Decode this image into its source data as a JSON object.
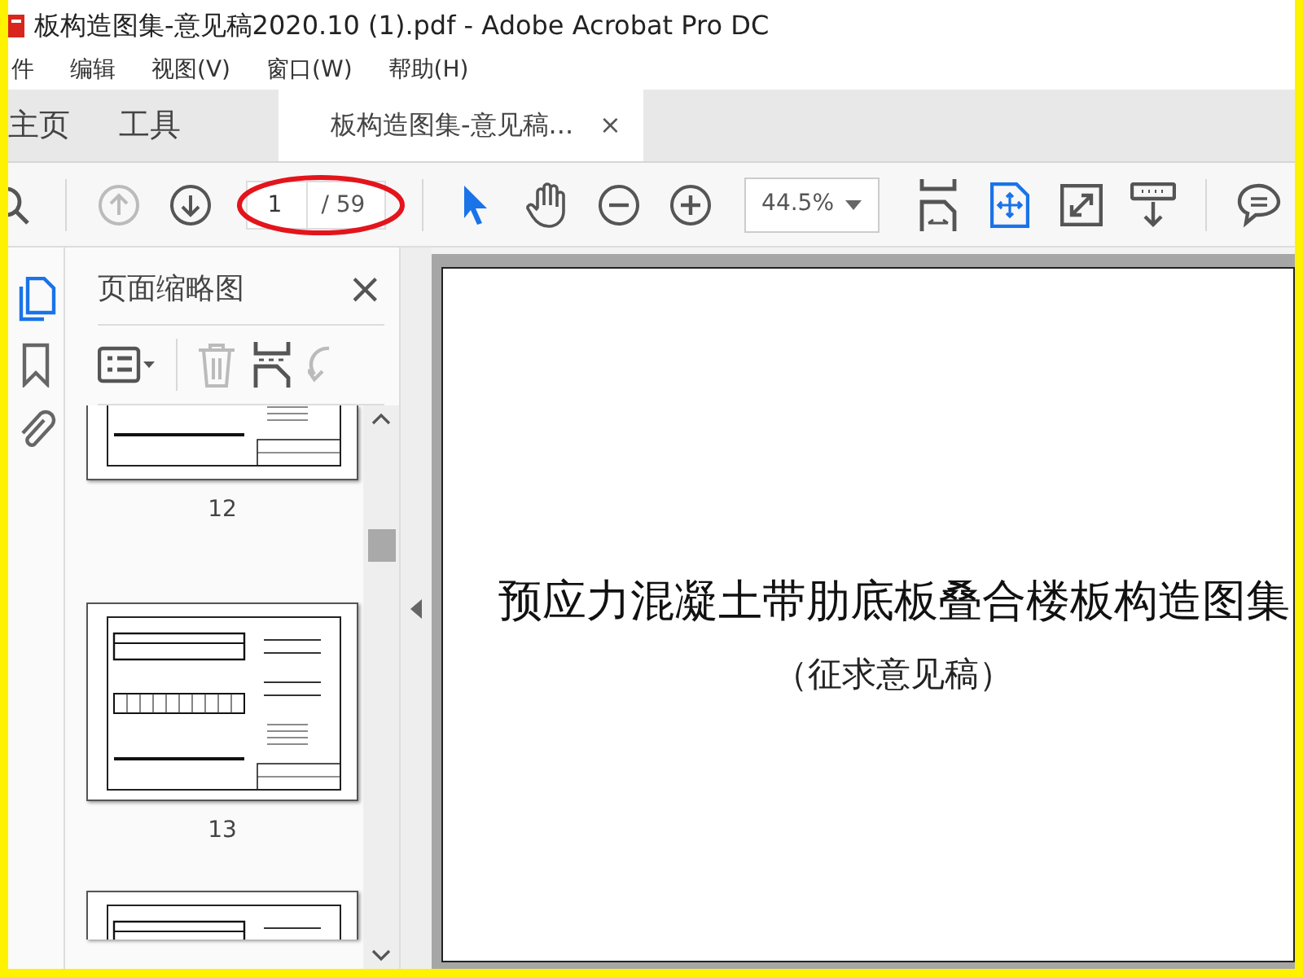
{
  "window": {
    "title": "板构造图集-意见稿2020.10 (1).pdf - Adobe Acrobat Pro DC"
  },
  "menu": [
    "件",
    "编辑",
    "视图(V)",
    "窗口(W)",
    "帮助(H)"
  ],
  "tabs": [
    {
      "label": "主页",
      "kind": "nav",
      "selected": false
    },
    {
      "label": "工具",
      "kind": "nav",
      "selected": false
    },
    {
      "label": "板构造图集-意见稿...",
      "kind": "document",
      "selected": true,
      "close": "×"
    }
  ],
  "toolbar": {
    "tools": [
      {
        "kind": "search",
        "disabled": false,
        "selected": false
      },
      {
        "kind": "divider"
      },
      {
        "kind": "prev-page",
        "disabled": true,
        "selected": false
      },
      {
        "kind": "next-page",
        "disabled": false,
        "selected": false
      },
      {
        "kind": "page-field",
        "value": "1",
        "total": "/ 59",
        "circled": true
      },
      {
        "kind": "divider"
      },
      {
        "kind": "select",
        "disabled": false,
        "selected": true
      },
      {
        "kind": "hand",
        "disabled": false,
        "selected": false
      },
      {
        "kind": "zoom-out",
        "disabled": false,
        "selected": false
      },
      {
        "kind": "zoom-in",
        "disabled": false,
        "selected": false
      },
      {
        "kind": "zoom-field",
        "value": "44.5%"
      },
      {
        "kind": "scroll-mode",
        "disabled": false,
        "selected": false
      },
      {
        "kind": "fit-page",
        "disabled": false,
        "selected": true
      },
      {
        "kind": "full-screen",
        "disabled": false,
        "selected": false
      },
      {
        "kind": "read-mode",
        "disabled": false,
        "selected": false
      },
      {
        "kind": "divider"
      },
      {
        "kind": "comment",
        "disabled": false,
        "selected": false
      }
    ]
  },
  "rail": [
    {
      "kind": "pages",
      "selected": true
    },
    {
      "kind": "bookmarks",
      "selected": false
    },
    {
      "kind": "attachments",
      "selected": false
    }
  ],
  "panel": {
    "title": "页面缩略图",
    "close": "×",
    "tools": [
      {
        "kind": "options",
        "disabled": false
      },
      {
        "kind": "divider"
      },
      {
        "kind": "delete",
        "disabled": true
      },
      {
        "kind": "insert",
        "disabled": false
      },
      {
        "kind": "rotate",
        "disabled": true
      }
    ],
    "thumbnails": [
      {
        "kind": "cut-top",
        "label": "12"
      },
      {
        "kind": "full",
        "label": "13"
      },
      {
        "kind": "cut-bottom"
      }
    ]
  },
  "document": {
    "title": "预应力混凝土带肋底板叠合楼板构造图集",
    "subtitle": "（征求意见稿）"
  }
}
